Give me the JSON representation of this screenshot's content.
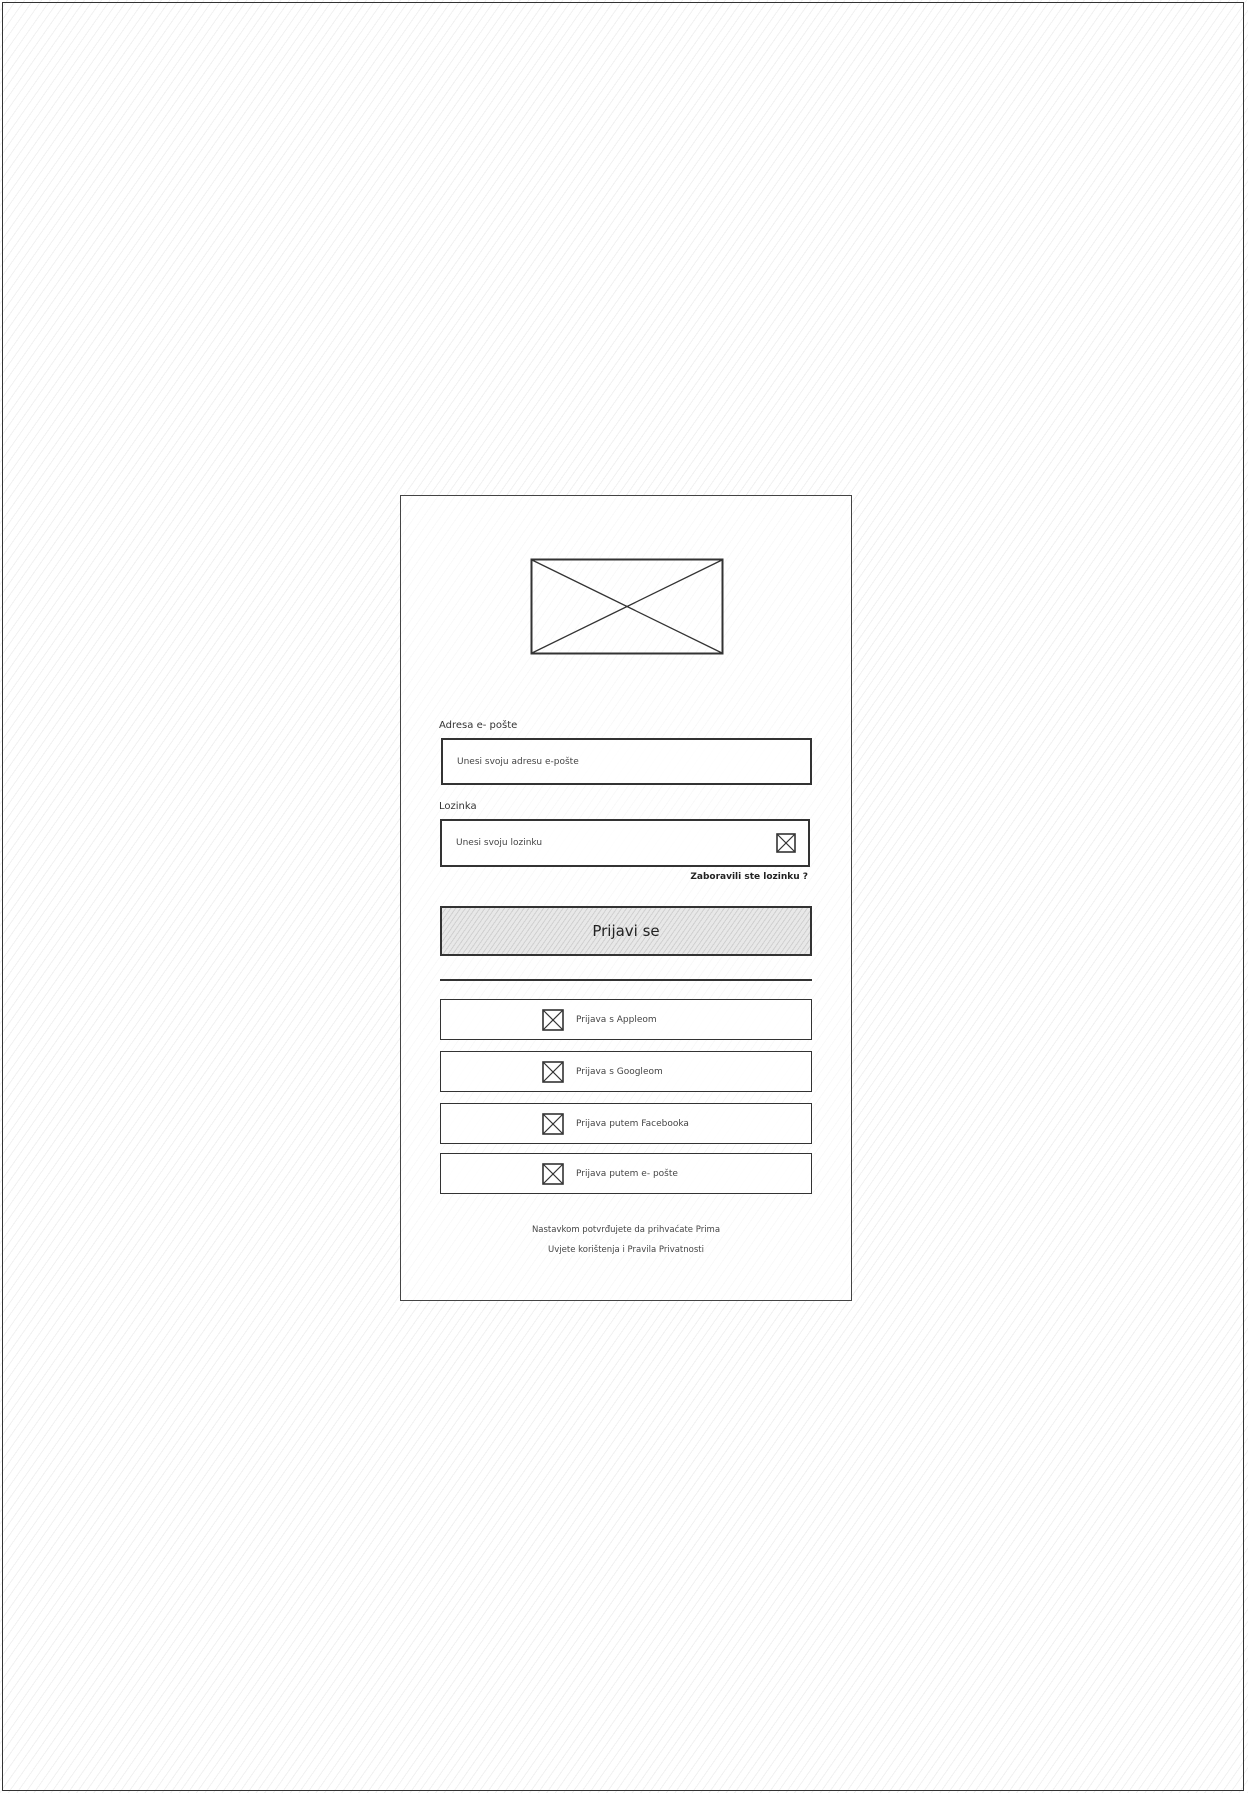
{
  "email": {
    "label": "Adresa e- pošte",
    "placeholder": "Unesi svoju adresu e-pošte"
  },
  "password": {
    "label": "Lozinka",
    "placeholder": "Unesi svoju lozinku",
    "toggle_icon": "image-placeholder-icon"
  },
  "forgot_password": "Zaboravili ste lozinku ?",
  "login_button": "Prijavi se",
  "logo_icon": "image-placeholder-icon",
  "social": [
    {
      "label": "Prijava s Appleom",
      "icon": "image-placeholder-icon"
    },
    {
      "label": "Prijava s Googleom",
      "icon": "image-placeholder-icon"
    },
    {
      "label": "Prijava putem Facebooka",
      "icon": "image-placeholder-icon"
    },
    {
      "label": "Prijava putem e- pošte",
      "icon": "image-placeholder-icon"
    }
  ],
  "footer": {
    "line1": "Nastavkom potvrđujete da prihvaćate Prima",
    "line2": "Uvjete korištenja i Pravila Privatnosti"
  }
}
